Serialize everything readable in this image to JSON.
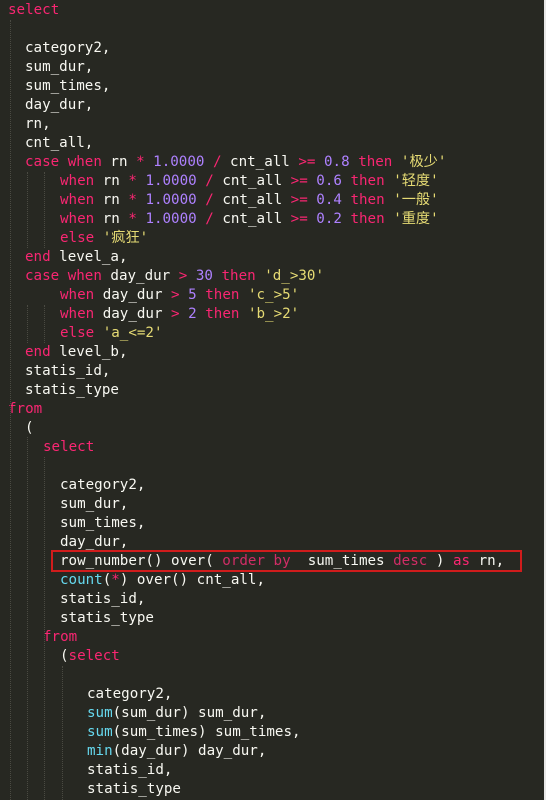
{
  "editor": {
    "language": "sql",
    "theme_colors": {
      "background": "#272822",
      "text": "#f8f8f2",
      "keyword": "#f92672",
      "number": "#ae81ff",
      "string": "#e6db74",
      "function": "#66d9ef",
      "highlight_box": "#d01c1c"
    },
    "lines": [
      {
        "indent": 0,
        "tokens": [
          {
            "t": "select",
            "c": "kw"
          }
        ]
      },
      {
        "indent": 0,
        "tokens": []
      },
      {
        "indent": 1,
        "tokens": [
          {
            "t": "category2,",
            "c": ""
          }
        ]
      },
      {
        "indent": 1,
        "tokens": [
          {
            "t": "sum_dur,",
            "c": ""
          }
        ]
      },
      {
        "indent": 1,
        "tokens": [
          {
            "t": "sum_times,",
            "c": ""
          }
        ]
      },
      {
        "indent": 1,
        "tokens": [
          {
            "t": "day_dur,",
            "c": ""
          }
        ]
      },
      {
        "indent": 1,
        "tokens": [
          {
            "t": "rn,",
            "c": ""
          }
        ]
      },
      {
        "indent": 1,
        "tokens": [
          {
            "t": "cnt_all,",
            "c": ""
          }
        ]
      },
      {
        "indent": 1,
        "tokens": [
          {
            "t": "case",
            "c": "kw"
          },
          {
            "t": " ",
            "c": ""
          },
          {
            "t": "when",
            "c": "kw"
          },
          {
            "t": " rn ",
            "c": ""
          },
          {
            "t": "*",
            "c": "op"
          },
          {
            "t": " ",
            "c": ""
          },
          {
            "t": "1.0000",
            "c": "num"
          },
          {
            "t": " ",
            "c": ""
          },
          {
            "t": "/",
            "c": "op"
          },
          {
            "t": " cnt_all ",
            "c": ""
          },
          {
            "t": ">=",
            "c": "op"
          },
          {
            "t": " ",
            "c": ""
          },
          {
            "t": "0.8",
            "c": "num"
          },
          {
            "t": " ",
            "c": ""
          },
          {
            "t": "then",
            "c": "kw"
          },
          {
            "t": " ",
            "c": ""
          },
          {
            "t": "'极少'",
            "c": "str"
          }
        ]
      },
      {
        "indent": 3,
        "tokens": [
          {
            "t": "when",
            "c": "kw"
          },
          {
            "t": " rn ",
            "c": ""
          },
          {
            "t": "*",
            "c": "op"
          },
          {
            "t": " ",
            "c": ""
          },
          {
            "t": "1.0000",
            "c": "num"
          },
          {
            "t": " ",
            "c": ""
          },
          {
            "t": "/",
            "c": "op"
          },
          {
            "t": " cnt_all ",
            "c": ""
          },
          {
            "t": ">=",
            "c": "op"
          },
          {
            "t": " ",
            "c": ""
          },
          {
            "t": "0.6",
            "c": "num"
          },
          {
            "t": " ",
            "c": ""
          },
          {
            "t": "then",
            "c": "kw"
          },
          {
            "t": " ",
            "c": ""
          },
          {
            "t": "'轻度'",
            "c": "str"
          }
        ]
      },
      {
        "indent": 3,
        "tokens": [
          {
            "t": "when",
            "c": "kw"
          },
          {
            "t": " rn ",
            "c": ""
          },
          {
            "t": "*",
            "c": "op"
          },
          {
            "t": " ",
            "c": ""
          },
          {
            "t": "1.0000",
            "c": "num"
          },
          {
            "t": " ",
            "c": ""
          },
          {
            "t": "/",
            "c": "op"
          },
          {
            "t": " cnt_all ",
            "c": ""
          },
          {
            "t": ">=",
            "c": "op"
          },
          {
            "t": " ",
            "c": ""
          },
          {
            "t": "0.4",
            "c": "num"
          },
          {
            "t": " ",
            "c": ""
          },
          {
            "t": "then",
            "c": "kw"
          },
          {
            "t": " ",
            "c": ""
          },
          {
            "t": "'一般'",
            "c": "str"
          }
        ]
      },
      {
        "indent": 3,
        "tokens": [
          {
            "t": "when",
            "c": "kw"
          },
          {
            "t": " rn ",
            "c": ""
          },
          {
            "t": "*",
            "c": "op"
          },
          {
            "t": " ",
            "c": ""
          },
          {
            "t": "1.0000",
            "c": "num"
          },
          {
            "t": " ",
            "c": ""
          },
          {
            "t": "/",
            "c": "op"
          },
          {
            "t": " cnt_all ",
            "c": ""
          },
          {
            "t": ">=",
            "c": "op"
          },
          {
            "t": " ",
            "c": ""
          },
          {
            "t": "0.2",
            "c": "num"
          },
          {
            "t": " ",
            "c": ""
          },
          {
            "t": "then",
            "c": "kw"
          },
          {
            "t": " ",
            "c": ""
          },
          {
            "t": "'重度'",
            "c": "str"
          }
        ]
      },
      {
        "indent": 3,
        "tokens": [
          {
            "t": "else",
            "c": "kw"
          },
          {
            "t": " ",
            "c": ""
          },
          {
            "t": "'疯狂'",
            "c": "str"
          }
        ]
      },
      {
        "indent": 1,
        "tokens": [
          {
            "t": "end",
            "c": "kw"
          },
          {
            "t": " level_a,",
            "c": ""
          }
        ]
      },
      {
        "indent": 1,
        "tokens": [
          {
            "t": "case",
            "c": "kw"
          },
          {
            "t": " ",
            "c": ""
          },
          {
            "t": "when",
            "c": "kw"
          },
          {
            "t": " day_dur ",
            "c": ""
          },
          {
            "t": ">",
            "c": "op"
          },
          {
            "t": " ",
            "c": ""
          },
          {
            "t": "30",
            "c": "num"
          },
          {
            "t": " ",
            "c": ""
          },
          {
            "t": "then",
            "c": "kw"
          },
          {
            "t": " ",
            "c": ""
          },
          {
            "t": "'d_>30'",
            "c": "str"
          }
        ]
      },
      {
        "indent": 3,
        "tokens": [
          {
            "t": "when",
            "c": "kw"
          },
          {
            "t": " day_dur ",
            "c": ""
          },
          {
            "t": ">",
            "c": "op"
          },
          {
            "t": " ",
            "c": ""
          },
          {
            "t": "5",
            "c": "num"
          },
          {
            "t": " ",
            "c": ""
          },
          {
            "t": "then",
            "c": "kw"
          },
          {
            "t": " ",
            "c": ""
          },
          {
            "t": "'c_>5'",
            "c": "str"
          }
        ]
      },
      {
        "indent": 3,
        "tokens": [
          {
            "t": "when",
            "c": "kw"
          },
          {
            "t": " day_dur ",
            "c": ""
          },
          {
            "t": ">",
            "c": "op"
          },
          {
            "t": " ",
            "c": ""
          },
          {
            "t": "2",
            "c": "num"
          },
          {
            "t": " ",
            "c": ""
          },
          {
            "t": "then",
            "c": "kw"
          },
          {
            "t": " ",
            "c": ""
          },
          {
            "t": "'b_>2'",
            "c": "str"
          }
        ]
      },
      {
        "indent": 3,
        "tokens": [
          {
            "t": "else",
            "c": "kw"
          },
          {
            "t": " ",
            "c": ""
          },
          {
            "t": "'a_<=2'",
            "c": "str"
          }
        ]
      },
      {
        "indent": 1,
        "tokens": [
          {
            "t": "end",
            "c": "kw"
          },
          {
            "t": " level_b,",
            "c": ""
          }
        ]
      },
      {
        "indent": 1,
        "tokens": [
          {
            "t": "statis_id,",
            "c": ""
          }
        ]
      },
      {
        "indent": 1,
        "tokens": [
          {
            "t": "statis_type",
            "c": ""
          }
        ]
      },
      {
        "indent": 0,
        "tokens": [
          {
            "t": "from",
            "c": "kw"
          }
        ]
      },
      {
        "indent": 1,
        "tokens": [
          {
            "t": "(",
            "c": ""
          }
        ]
      },
      {
        "indent": 2,
        "tokens": [
          {
            "t": "select",
            "c": "kw"
          }
        ]
      },
      {
        "indent": 0,
        "tokens": []
      },
      {
        "indent": 3,
        "tokens": [
          {
            "t": "category2,",
            "c": ""
          }
        ]
      },
      {
        "indent": 3,
        "tokens": [
          {
            "t": "sum_dur,",
            "c": ""
          }
        ]
      },
      {
        "indent": 3,
        "tokens": [
          {
            "t": "sum_times,",
            "c": ""
          }
        ]
      },
      {
        "indent": 3,
        "tokens": [
          {
            "t": "day_dur,",
            "c": ""
          }
        ]
      },
      {
        "indent": 3,
        "highlighted": true,
        "tokens": [
          {
            "t": "row_number() over( ",
            "c": ""
          },
          {
            "t": "order by",
            "c": "kwd"
          },
          {
            "t": "  sum_times ",
            "c": ""
          },
          {
            "t": "desc",
            "c": "kwd"
          },
          {
            "t": " ) ",
            "c": ""
          },
          {
            "t": "as",
            "c": "kw"
          },
          {
            "t": " rn,",
            "c": ""
          }
        ]
      },
      {
        "indent": 3,
        "tokens": [
          {
            "t": "count",
            "c": "fn"
          },
          {
            "t": "(",
            "c": ""
          },
          {
            "t": "*",
            "c": "op"
          },
          {
            "t": ") over() cnt_all,",
            "c": ""
          }
        ]
      },
      {
        "indent": 3,
        "tokens": [
          {
            "t": "statis_id,",
            "c": ""
          }
        ]
      },
      {
        "indent": 3,
        "tokens": [
          {
            "t": "statis_type",
            "c": ""
          }
        ]
      },
      {
        "indent": 2,
        "tokens": [
          {
            "t": "from",
            "c": "kw"
          }
        ]
      },
      {
        "indent": 3,
        "tokens": [
          {
            "t": "(",
            "c": ""
          },
          {
            "t": "select",
            "c": "kw"
          }
        ]
      },
      {
        "indent": 0,
        "tokens": []
      },
      {
        "indent": 4,
        "tokens": [
          {
            "t": "category2,",
            "c": ""
          }
        ]
      },
      {
        "indent": 4,
        "tokens": [
          {
            "t": "sum",
            "c": "fn"
          },
          {
            "t": "(sum_dur) sum_dur,",
            "c": ""
          }
        ]
      },
      {
        "indent": 4,
        "tokens": [
          {
            "t": "sum",
            "c": "fn"
          },
          {
            "t": "(sum_times) sum_times,",
            "c": ""
          }
        ]
      },
      {
        "indent": 4,
        "tokens": [
          {
            "t": "min",
            "c": "fn"
          },
          {
            "t": "(day_dur) day_dur,",
            "c": ""
          }
        ]
      },
      {
        "indent": 4,
        "tokens": [
          {
            "t": "statis_id,",
            "c": ""
          }
        ]
      },
      {
        "indent": 4,
        "tokens": [
          {
            "t": "statis_type",
            "c": ""
          }
        ]
      }
    ]
  }
}
